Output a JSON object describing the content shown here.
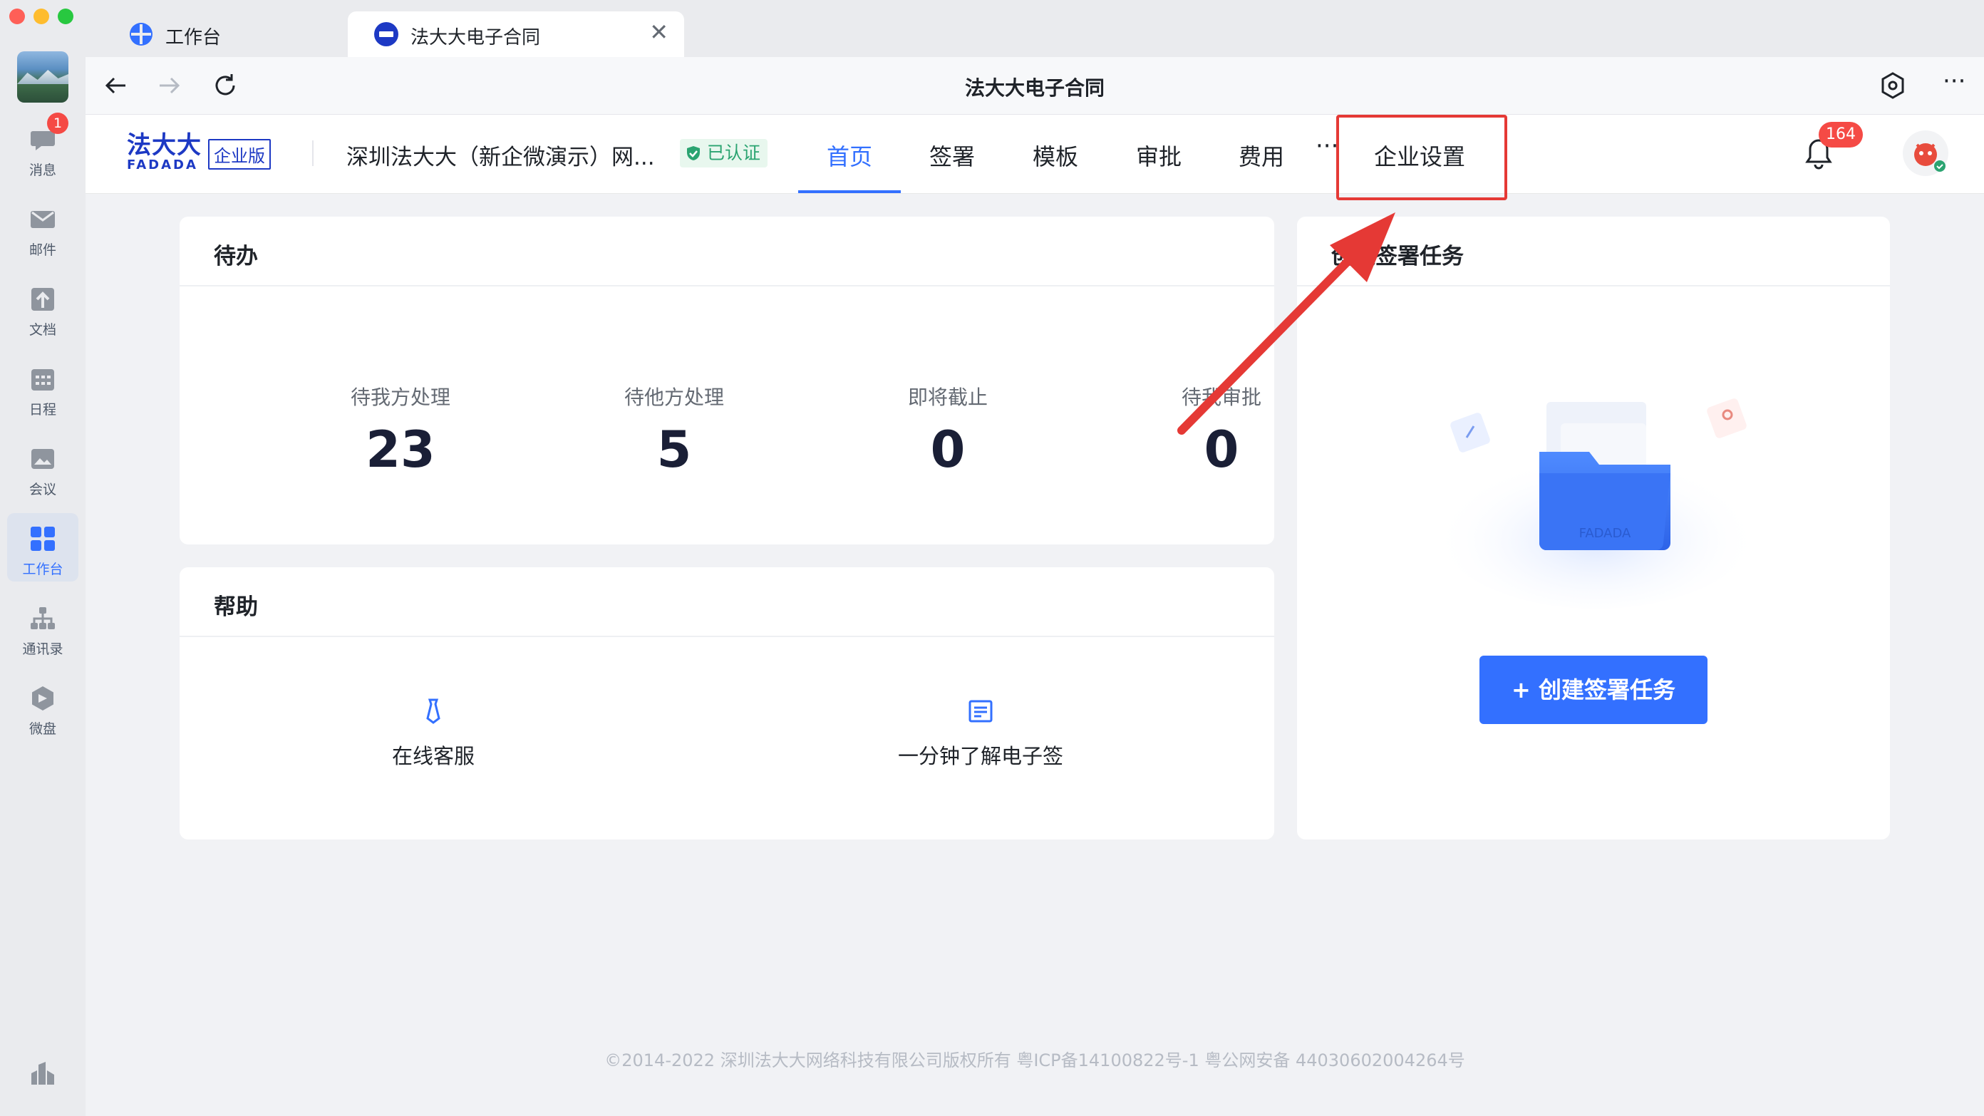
{
  "rail": {
    "items": [
      {
        "label": "消息",
        "badge": "1"
      },
      {
        "label": "邮件"
      },
      {
        "label": "文档"
      },
      {
        "label": "日程"
      },
      {
        "label": "会议"
      },
      {
        "label": "工作台",
        "active": true
      },
      {
        "label": "通讯录"
      },
      {
        "label": "微盘"
      }
    ]
  },
  "tabs": [
    {
      "label": "工作台"
    },
    {
      "label": "法大大电子合同",
      "active": true
    }
  ],
  "navbar": {
    "title": "法大大电子合同"
  },
  "header": {
    "logo": "法大大",
    "logo_sub": "FADADA",
    "edition": "企业版",
    "company": "深圳法大大（新企微演示）网...",
    "verified": "已认证",
    "nav": [
      "首页",
      "签署",
      "模板",
      "审批",
      "费用"
    ],
    "more": "···",
    "settings": "企业设置",
    "notification_count": "164"
  },
  "todo": {
    "title": "待办",
    "stats": [
      {
        "label": "待我方处理",
        "value": "23"
      },
      {
        "label": "待他方处理",
        "value": "5"
      },
      {
        "label": "即将截止",
        "value": "0"
      },
      {
        "label": "待我审批",
        "value": "0"
      }
    ]
  },
  "help": {
    "title": "帮助",
    "items": [
      {
        "label": "在线客服",
        "icon": "tie-icon"
      },
      {
        "label": "一分钟了解电子签",
        "icon": "document-icon"
      }
    ]
  },
  "create": {
    "title": "创建签署任务",
    "button": "+ 创建签署任务",
    "illustration_text": "FADADA"
  },
  "footer": "©2014-2022 深圳法大大网络科技有限公司版权所有 粤ICP备14100822号-1 粤公网安备 44030602004264号",
  "colors": {
    "accent": "#3370ff",
    "highlight": "#e53935",
    "badge": "#f54a45"
  }
}
